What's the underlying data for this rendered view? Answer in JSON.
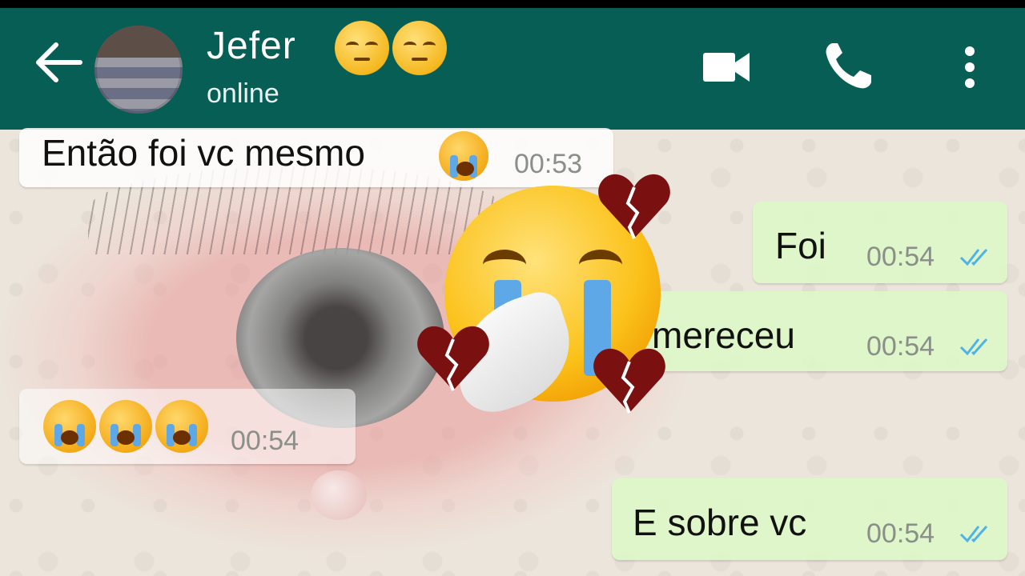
{
  "header": {
    "contact_name": "Jefer",
    "status": "online",
    "name_emojis": [
      "pensive-face",
      "pensive-face"
    ]
  },
  "messages": [
    {
      "direction": "incoming",
      "text": "Então foi vc mesmo",
      "emoji": "loudly-crying-face",
      "time": "00:53"
    },
    {
      "direction": "outgoing",
      "text": "Foi",
      "time": "00:54",
      "status": "read"
    },
    {
      "direction": "outgoing",
      "text": "mereceu",
      "time": "00:54",
      "status": "read"
    },
    {
      "direction": "incoming",
      "text": "",
      "emojis": [
        "loudly-crying-face",
        "loudly-crying-face",
        "loudly-crying-face"
      ],
      "time": "00:54"
    },
    {
      "direction": "outgoing",
      "text": "E sobre vc",
      "time": "00:54",
      "status": "read"
    }
  ],
  "overlay": {
    "center_emoji": "crying-face-with-tissue",
    "hearts": [
      "broken-heart",
      "broken-heart",
      "broken-heart"
    ]
  },
  "colors": {
    "header": "#075e54",
    "outgoing_bubble": "#dcf8c6",
    "incoming_bubble": "#ffffff",
    "read_ticks": "#4fb3e8"
  }
}
